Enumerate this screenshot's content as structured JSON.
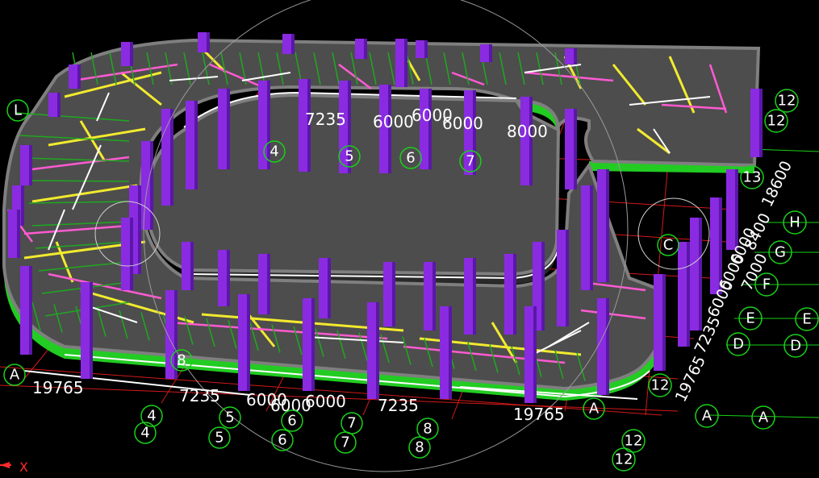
{
  "colors": {
    "background": "#000000",
    "grid": "#d21a1a",
    "column": "#8a2be2",
    "column_dark": "#5a17a8",
    "slab": "#4d4d4d",
    "slab_edge": "#7f7f7f",
    "slab_side": "#22cc22",
    "beam_yellow": "#f2ea2e",
    "beam_magenta": "#ff5ad2",
    "beam_green": "#1fa81f",
    "beam_white": "#ffffff",
    "axis_bubble": "#19d119"
  },
  "axis_indicator": {
    "label": "X",
    "icon": "x-axis-arrow-icon"
  },
  "dimensions": {
    "bottom": [
      "19765",
      "7235",
      "6000",
      "6000",
      "6000",
      "7235",
      "19765"
    ],
    "inner": [
      "7235",
      "6000",
      "6000",
      "6000",
      "8000"
    ],
    "right": [
      "19765",
      "7235",
      "6000",
      "6000",
      "6000",
      "8400",
      "18600",
      "7000"
    ]
  },
  "axis_labels": {
    "columns": [
      "4",
      "4",
      "4",
      "5",
      "5",
      "5",
      "6",
      "6",
      "6",
      "7",
      "7",
      "7",
      "8",
      "8",
      "8",
      "12",
      "12",
      "12",
      "12",
      "12",
      "13"
    ],
    "rows": [
      "A",
      "A",
      "A",
      "A",
      "C",
      "D",
      "D",
      "E",
      "E",
      "F",
      "G",
      "H",
      "L"
    ]
  }
}
